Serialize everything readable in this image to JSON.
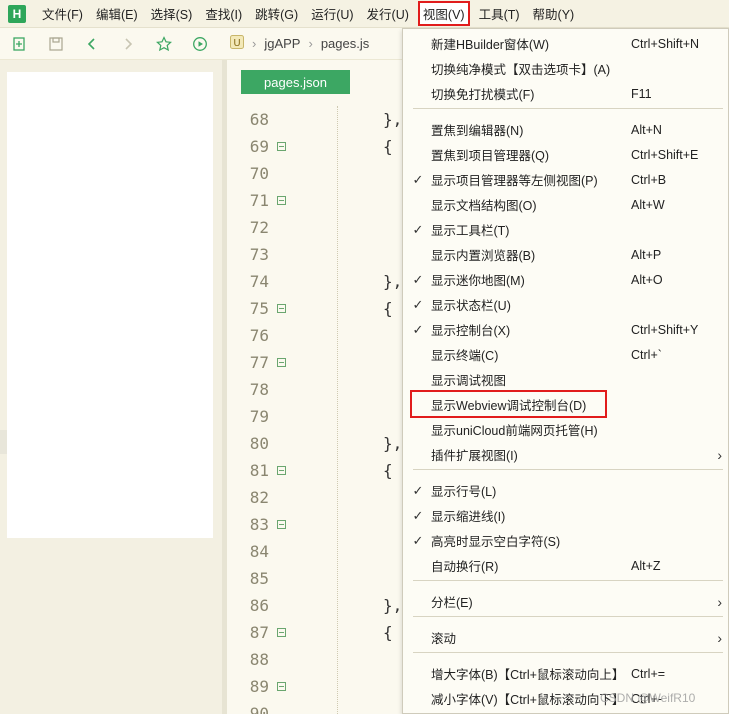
{
  "menubar": {
    "logo": "H",
    "items": [
      "文件(F)",
      "编辑(E)",
      "选择(S)",
      "查找(I)",
      "跳转(G)",
      "运行(U)",
      "发行(U)",
      "视图(V)",
      "工具(T)",
      "帮助(Y)"
    ]
  },
  "toolbar": {
    "icons": [
      "new-file-icon",
      "save-icon",
      "back-arrow-icon",
      "forward-arrow-icon",
      "star-icon",
      "run-icon"
    ],
    "breadcrumb": {
      "project": "jgAPP",
      "file": "pages.js"
    }
  },
  "editor": {
    "tab": "pages.json",
    "lines": [
      "68",
      "69",
      "70",
      "71",
      "72",
      "73",
      "74",
      "75",
      "76",
      "77",
      "78",
      "79",
      "80",
      "81",
      "82",
      "83",
      "84",
      "85",
      "86",
      "87",
      "88",
      "89",
      "90"
    ],
    "code": [
      "},",
      "{",
      "",
      "",
      "",
      "",
      "},",
      "{",
      "",
      "",
      "",
      "",
      "},",
      "{",
      "",
      "",
      "",
      "",
      "},",
      "{",
      "",
      "",
      ""
    ]
  },
  "dropdown": {
    "items": [
      {
        "label": "新建HBuilder窗体(W)",
        "shortcut": "Ctrl+Shift+N"
      },
      {
        "label": "切换纯净模式【双击选项卡】(A)",
        "shortcut": ""
      },
      {
        "label": "切换免打扰模式(F)",
        "shortcut": "F11"
      },
      {
        "label": "置焦到编辑器(N)",
        "shortcut": "Alt+N"
      },
      {
        "label": "置焦到项目管理器(Q)",
        "shortcut": "Ctrl+Shift+E"
      },
      {
        "label": "显示项目管理器等左侧视图(P)",
        "shortcut": "Ctrl+B",
        "checked": true
      },
      {
        "label": "显示文档结构图(O)",
        "shortcut": "Alt+W"
      },
      {
        "label": "显示工具栏(T)",
        "shortcut": "",
        "checked": true
      },
      {
        "label": "显示内置浏览器(B)",
        "shortcut": "Alt+P"
      },
      {
        "label": "显示迷你地图(M)",
        "shortcut": "Alt+O",
        "checked": true
      },
      {
        "label": "显示状态栏(U)",
        "shortcut": "",
        "checked": true
      },
      {
        "label": "显示控制台(X)",
        "shortcut": "Ctrl+Shift+Y",
        "checked": true
      },
      {
        "label": "显示终端(C)",
        "shortcut": "Ctrl+`"
      },
      {
        "label": "显示调试视图",
        "shortcut": ""
      },
      {
        "label": "显示Webview调试控制台(D)",
        "shortcut": ""
      },
      {
        "label": "显示uniCloud前端网页托管(H)",
        "shortcut": ""
      },
      {
        "label": "插件扩展视图(I)",
        "shortcut": "",
        "submenu": true
      },
      {
        "label": "显示行号(L)",
        "shortcut": "",
        "checked": true
      },
      {
        "label": "显示缩进线(I)",
        "shortcut": "",
        "checked": true
      },
      {
        "label": "高亮时显示空白字符(S)",
        "shortcut": "",
        "checked": true
      },
      {
        "label": "自动换行(R)",
        "shortcut": "Alt+Z"
      },
      {
        "label": "分栏(E)",
        "shortcut": "",
        "submenu": true
      },
      {
        "label": "滚动",
        "shortcut": "",
        "submenu": true
      },
      {
        "label": "增大字体(B)【Ctrl+鼠标滚动向上】",
        "shortcut": "Ctrl+="
      },
      {
        "label": "减小字体(V)【Ctrl+鼠标滚动向下】",
        "shortcut": "Ctrl+-"
      }
    ]
  },
  "watermark": "CSDN @WeifR10",
  "colors": {
    "accent_green": "#3ca763",
    "highlight_red": "#e11c1c",
    "background": "#fbf9ef"
  }
}
